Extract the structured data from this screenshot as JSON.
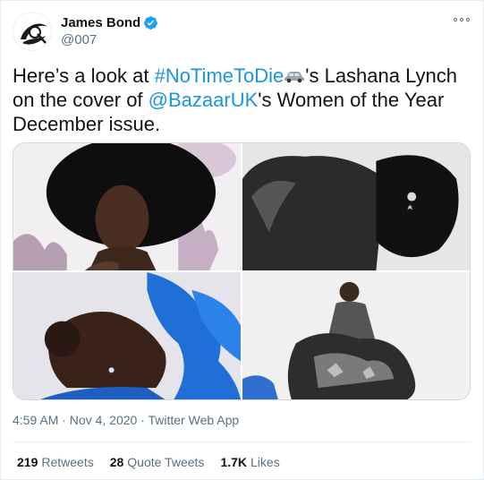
{
  "author": {
    "display_name": "James Bond",
    "handle": "@007",
    "verified_icon": "verified-badge-icon",
    "avatar_icon": "007-logo-avatar",
    "more_icon": "more-options-icon"
  },
  "tweet": {
    "text_prefix": "Here’s a look at ",
    "hashtag": "#NoTimeToDie",
    "emoji": "car-emoji-icon",
    "text_middle": "'s Lashana Lynch on the cover of ",
    "mention": "@BazaarUK",
    "text_suffix": "'s Women of the Year December issue."
  },
  "media": {
    "photos": [
      "photo-1",
      "photo-2",
      "photo-3",
      "photo-4"
    ]
  },
  "meta": {
    "timestamp": "4:59 AM · Nov 4, 2020 · Twitter Web App"
  },
  "stats": {
    "retweets_count": "219",
    "retweets_label": "Retweets",
    "quotes_count": "28",
    "quotes_label": "Quote Tweets",
    "likes_count": "1.7K",
    "likes_label": "Likes"
  },
  "colors": {
    "link": "#1b95e0",
    "muted": "#5b7083",
    "border": "#e6ecf0"
  }
}
